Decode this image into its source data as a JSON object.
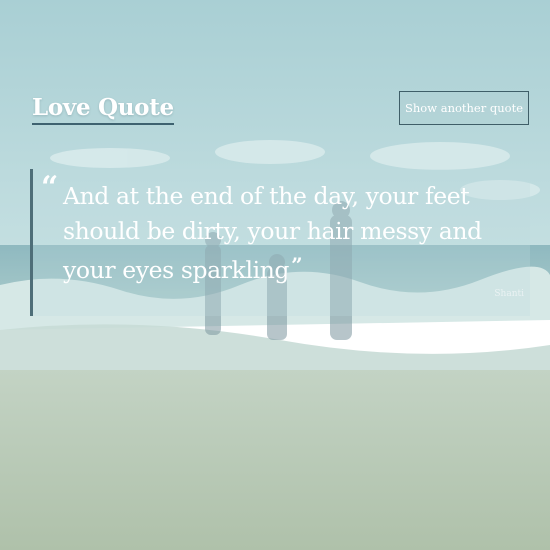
{
  "header": {
    "title": "Love Quote",
    "show_button_label": "Show another quote"
  },
  "quote": {
    "text": "And at the end of the day, your feet should be dirty, your hair messy and your eyes sparkling",
    "open_mark": "“",
    "close_mark": "”",
    "author": "Shanti"
  },
  "colors": {
    "sky": "#b6d8dc",
    "sand": "#b7c8b4",
    "accent_border": "#3e6270",
    "text": "#ffffff"
  }
}
